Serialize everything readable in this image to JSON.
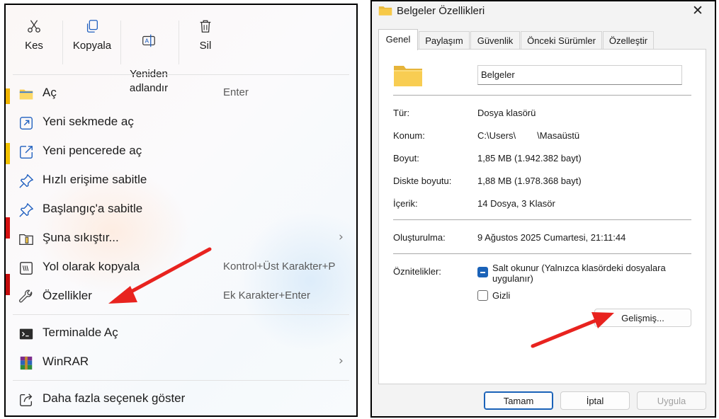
{
  "context_menu": {
    "top_actions": [
      {
        "label": "Kes",
        "icon": "scissors-icon"
      },
      {
        "label": "Kopyala",
        "icon": "copy-icon"
      },
      {
        "label": "Yeniden\nadlandır",
        "icon": "rename-icon"
      },
      {
        "label": "Sil",
        "icon": "trash-icon"
      }
    ],
    "items": [
      {
        "label": "Aç",
        "shortcut": "Enter",
        "icon": "folder-icon"
      },
      {
        "label": "Yeni sekmede aç",
        "shortcut": "",
        "icon": "open-in-new-tab-icon"
      },
      {
        "label": "Yeni pencerede aç",
        "shortcut": "",
        "icon": "open-in-new-window-icon"
      },
      {
        "label": "Hızlı erişime sabitle",
        "shortcut": "",
        "icon": "pin-icon"
      },
      {
        "label": "Başlangıç'a sabitle",
        "shortcut": "",
        "icon": "pin-icon"
      },
      {
        "label": "Şuna sıkıştır...",
        "shortcut": "",
        "icon": "zip-icon",
        "submenu": true
      },
      {
        "label": "Yol olarak kopyala",
        "shortcut": "Kontrol+Üst Karakter+P",
        "icon": "copy-path-icon"
      },
      {
        "label": "Özellikler",
        "shortcut": "Ek Karakter+Enter",
        "icon": "wrench-icon"
      },
      {
        "label": "Terminalde Aç",
        "shortcut": "",
        "icon": "terminal-icon"
      },
      {
        "label": "WinRAR",
        "shortcut": "",
        "icon": "winrar-icon",
        "submenu": true
      },
      {
        "label": "Daha fazla seçenek göster",
        "shortcut": "",
        "icon": "share-icon"
      }
    ],
    "chevron": "›"
  },
  "dialog": {
    "title": "Belgeler Özellikleri",
    "close": "✕",
    "tabs": [
      "Genel",
      "Paylaşım",
      "Güvenlik",
      "Önceki Sürümler",
      "Özelleştir"
    ],
    "active_tab": "Genel",
    "folder_name": "Belgeler",
    "properties": [
      {
        "label": "Tür:",
        "value": "Dosya klasörü"
      },
      {
        "label": "Konum:",
        "value_prefix": "C:\\Users\\",
        "value_suffix": "\\Masaüstü"
      },
      {
        "label": "Boyut:",
        "value": "1,85 MB (1.942.382 bayt)"
      },
      {
        "label": "Diskte boyutu:",
        "value": "1,88 MB (1.978.368 bayt)"
      },
      {
        "label": "İçerik:",
        "value": "14 Dosya, 3 Klasör"
      },
      {
        "label": "Oluşturulma:",
        "value": "9 Ağustos 2025 Cumartesi, 21:11:44"
      }
    ],
    "attributes_label": "Öznitelikler:",
    "readonly_label": "Salt okunur (Yalnızca klasördeki dosyalara\nuygulanır)",
    "readonly_state": "indeterminate",
    "hidden_label": "Gizli",
    "hidden_checked": false,
    "advanced_button": "Gelişmiş...",
    "ok_button": "Tamam",
    "cancel_button": "İptal",
    "apply_button": "Uygula"
  },
  "colors": {
    "annotation_arrow": "#e8231f",
    "accent": "#1a62b8",
    "folder": "#f7c948"
  }
}
